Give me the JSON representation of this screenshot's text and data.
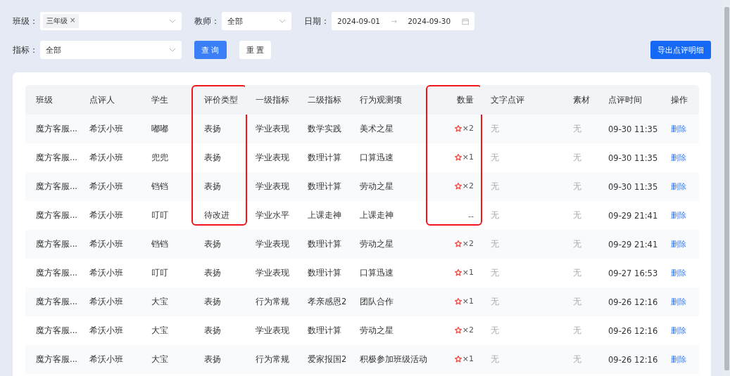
{
  "filters": {
    "class": {
      "label": "班级：",
      "tags": [
        "三年级"
      ],
      "remove": "×"
    },
    "teacher": {
      "label": "教师：",
      "value": "全部"
    },
    "date": {
      "label": "日期：",
      "start": "2024-09-01",
      "separator": "→",
      "end": "2024-09-30"
    },
    "indicator": {
      "label": "指标：",
      "value": "全部"
    },
    "query_button": "查 询",
    "reset_button": "重 置",
    "export_button": "导出点评明细"
  },
  "table": {
    "columns": [
      {
        "label": "班级",
        "highlighted": false
      },
      {
        "label": "点评人",
        "highlighted": false
      },
      {
        "label": "学生",
        "highlighted": false
      },
      {
        "label": "评价类型",
        "highlighted": true
      },
      {
        "label": "一级指标",
        "highlighted": false
      },
      {
        "label": "二级指标",
        "highlighted": false
      },
      {
        "label": "行为观测项",
        "highlighted": false
      },
      {
        "label": "数量",
        "highlighted": true
      },
      {
        "label": "文字点评",
        "highlighted": false
      },
      {
        "label": "素材",
        "highlighted": false
      },
      {
        "label": "点评时间",
        "highlighted": false
      },
      {
        "label": "操作",
        "highlighted": false
      }
    ],
    "rows": [
      {
        "class": "魔方客服...",
        "reviewer": "希沃小班",
        "student": "嘟嘟",
        "type": "表扬",
        "level1": "学业表现",
        "level2": "数学实践",
        "item": "美术之星",
        "flower": true,
        "quantity": "×2",
        "comment": "无",
        "material": "无",
        "time": "09-30 11:35",
        "action": "删除"
      },
      {
        "class": "魔方客服...",
        "reviewer": "希沃小班",
        "student": "兜兜",
        "type": "表扬",
        "level1": "学业表现",
        "level2": "数理计算",
        "item": "口算迅速",
        "flower": true,
        "quantity": "×1",
        "comment": "无",
        "material": "无",
        "time": "09-30 11:35",
        "action": "删除"
      },
      {
        "class": "魔方客服...",
        "reviewer": "希沃小班",
        "student": "铛铛",
        "type": "表扬",
        "level1": "学业表现",
        "level2": "数理计算",
        "item": "劳动之星",
        "flower": true,
        "quantity": "×2",
        "comment": "无",
        "material": "无",
        "time": "09-30 11:35",
        "action": "删除"
      },
      {
        "class": "魔方客服...",
        "reviewer": "希沃小班",
        "student": "叮叮",
        "type": "待改进",
        "level1": "学业水平",
        "level2": "上课走神",
        "item": "上课走神",
        "flower": false,
        "quantity": "--",
        "comment": "无",
        "material": "无",
        "time": "09-29 21:41",
        "action": "删除"
      },
      {
        "class": "魔方客服...",
        "reviewer": "希沃小班",
        "student": "铛铛",
        "type": "表扬",
        "level1": "学业表现",
        "level2": "数理计算",
        "item": "劳动之星",
        "flower": true,
        "quantity": "×2",
        "comment": "无",
        "material": "无",
        "time": "09-29 21:41",
        "action": "删除"
      },
      {
        "class": "魔方客服...",
        "reviewer": "希沃小班",
        "student": "叮叮",
        "type": "表扬",
        "level1": "学业表现",
        "level2": "数理计算",
        "item": "口算迅速",
        "flower": true,
        "quantity": "×1",
        "comment": "无",
        "material": "无",
        "time": "09-27 16:53",
        "action": "删除"
      },
      {
        "class": "魔方客服...",
        "reviewer": "希沃小班",
        "student": "大宝",
        "type": "表扬",
        "level1": "行为常规",
        "level2": "孝亲感恩2",
        "item": "团队合作",
        "flower": true,
        "quantity": "×1",
        "comment": "无",
        "material": "无",
        "time": "09-26 12:16",
        "action": "删除"
      },
      {
        "class": "魔方客服...",
        "reviewer": "希沃小班",
        "student": "大宝",
        "type": "表扬",
        "level1": "学业表现",
        "level2": "数理计算",
        "item": "劳动之星",
        "flower": true,
        "quantity": "×2",
        "comment": "无",
        "material": "无",
        "time": "09-26 12:16",
        "action": "删除"
      },
      {
        "class": "魔方客服...",
        "reviewer": "希沃小班",
        "student": "大宝",
        "type": "表扬",
        "level1": "行为常规",
        "level2": "爱家报国2",
        "item": "积极参加班级活动",
        "flower": true,
        "quantity": "×1",
        "comment": "无",
        "material": "无",
        "time": "09-26 12:16",
        "action": "删除"
      }
    ]
  }
}
